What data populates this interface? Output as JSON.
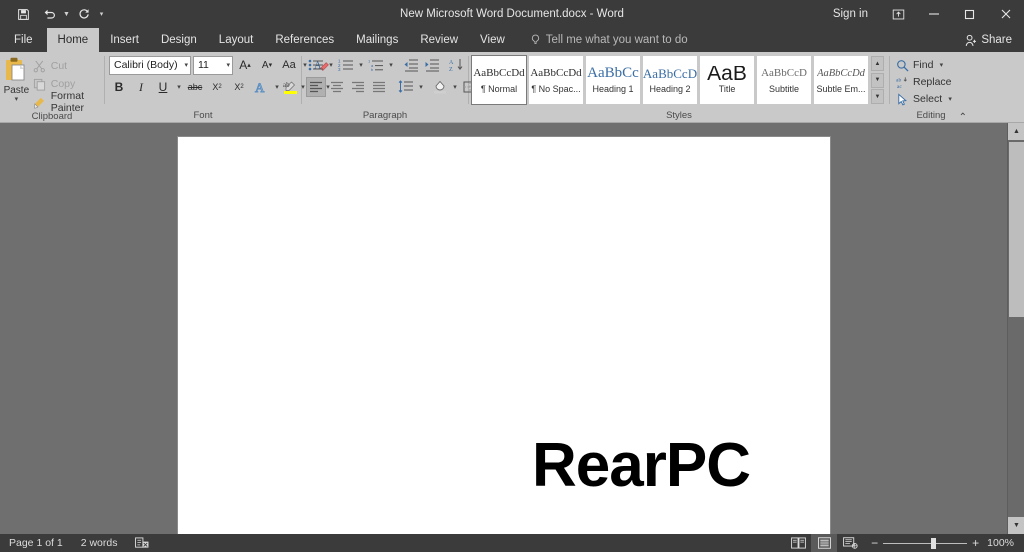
{
  "window": {
    "title": "New Microsoft Word Document.docx  -  Word",
    "signin_label": "Sign in",
    "ribbon_display_icon": "ribbon-display-options-icon",
    "minimize_icon": "minimize-icon",
    "restore_icon": "restore-icon",
    "close_icon": "close-icon"
  },
  "quick_access": {
    "save_icon": "save-icon",
    "undo_icon": "undo-icon",
    "redo_icon": "redo-icon",
    "customize_icon": "customize-quick-access-toolbar-icon"
  },
  "tabs": [
    {
      "label": "File",
      "active": false
    },
    {
      "label": "Home",
      "active": true
    },
    {
      "label": "Insert",
      "active": false
    },
    {
      "label": "Design",
      "active": false
    },
    {
      "label": "Layout",
      "active": false
    },
    {
      "label": "References",
      "active": false
    },
    {
      "label": "Mailings",
      "active": false
    },
    {
      "label": "Review",
      "active": false
    },
    {
      "label": "View",
      "active": false
    }
  ],
  "tell_me": {
    "placeholder": "Tell me what you want to do",
    "icon": "lightbulb-icon"
  },
  "share": {
    "label": "Share",
    "icon": "share-person-icon"
  },
  "ribbon": {
    "clipboard": {
      "label": "Clipboard",
      "paste_label": "Paste",
      "items": [
        {
          "label": "Cut",
          "icon": "scissors-icon",
          "disabled": true
        },
        {
          "label": "Copy",
          "icon": "copy-icon",
          "disabled": true
        },
        {
          "label": "Format Painter",
          "icon": "format-painter-icon",
          "disabled": false
        }
      ]
    },
    "font": {
      "label": "Font",
      "font_name": "Calibri (Body)",
      "font_size": "11",
      "grow_font": "A",
      "shrink_font": "A",
      "change_case": "Aa",
      "clear_formatting_icon": "clear-formatting-icon",
      "bold": "B",
      "italic": "I",
      "underline": "U",
      "strikethrough": "abc",
      "subscript": "X",
      "superscript": "X",
      "text_effects_icon": "text-effects-icon",
      "highlight_icon": "text-highlight-icon",
      "font_color_label": "A",
      "highlight_color": "#ffff00",
      "font_color": "#d92b2b"
    },
    "paragraph": {
      "label": "Paragraph",
      "bullets_icon": "bullet-list-icon",
      "numbering_icon": "numbered-list-icon",
      "multilevel_icon": "multilevel-list-icon",
      "decrease_indent_icon": "decrease-indent-icon",
      "increase_indent_icon": "increase-indent-icon",
      "sort_icon": "sort-icon",
      "show_marks_icon": "show-formatting-marks-icon",
      "align_left_icon": "align-left-icon",
      "align_center_icon": "align-center-icon",
      "align_right_icon": "align-right-icon",
      "justify_icon": "justify-icon",
      "line_spacing_icon": "line-spacing-icon",
      "shading_icon": "shading-icon",
      "borders_icon": "borders-icon"
    },
    "styles": {
      "label": "Styles",
      "items": [
        {
          "sample": "AaBbCcDd",
          "name": "¶ Normal",
          "selected": true,
          "kind": "body"
        },
        {
          "sample": "AaBbCcDd",
          "name": "¶ No Spac...",
          "selected": false,
          "kind": "body"
        },
        {
          "sample": "AaBbCc",
          "name": "Heading 1",
          "selected": false,
          "kind": "h1"
        },
        {
          "sample": "AaBbCcD",
          "name": "Heading 2",
          "selected": false,
          "kind": "h2"
        },
        {
          "sample": "AaB",
          "name": "Title",
          "selected": false,
          "kind": "title"
        },
        {
          "sample": "AaBbCcD",
          "name": "Subtitle",
          "selected": false,
          "kind": "sub"
        },
        {
          "sample": "AaBbCcDd",
          "name": "Subtle Em...",
          "selected": false,
          "kind": "em"
        }
      ],
      "scroll_up_icon": "gallery-scroll-up-icon",
      "scroll_down_icon": "gallery-scroll-down-icon",
      "more_icon": "gallery-more-icon"
    },
    "editing": {
      "label": "Editing",
      "items": [
        {
          "label": "Find",
          "icon": "find-icon",
          "has_caret": true
        },
        {
          "label": "Replace",
          "icon": "replace-icon",
          "has_caret": false
        },
        {
          "label": "Select",
          "icon": "select-icon",
          "has_caret": true
        }
      ],
      "collapse_icon": "collapse-ribbon-icon"
    }
  },
  "document": {
    "body_text": "RearPC"
  },
  "status": {
    "page_info": "Page 1 of 1",
    "word_count": "2 words",
    "proofing_icon": "proofing-errors-icon",
    "views": [
      {
        "name": "read-mode",
        "icon": "read-mode-icon",
        "active": false
      },
      {
        "name": "print-layout",
        "icon": "print-layout-icon",
        "active": true
      },
      {
        "name": "web-layout",
        "icon": "web-layout-icon",
        "active": false
      }
    ],
    "zoom_out": "−",
    "zoom_in": "+",
    "zoom_level": "100%"
  },
  "colors": {
    "chrome_dark": "#3b3b3b",
    "ribbon": "#c9c9c9",
    "workspace": "#6f6f6f",
    "page": "#ffffff"
  }
}
